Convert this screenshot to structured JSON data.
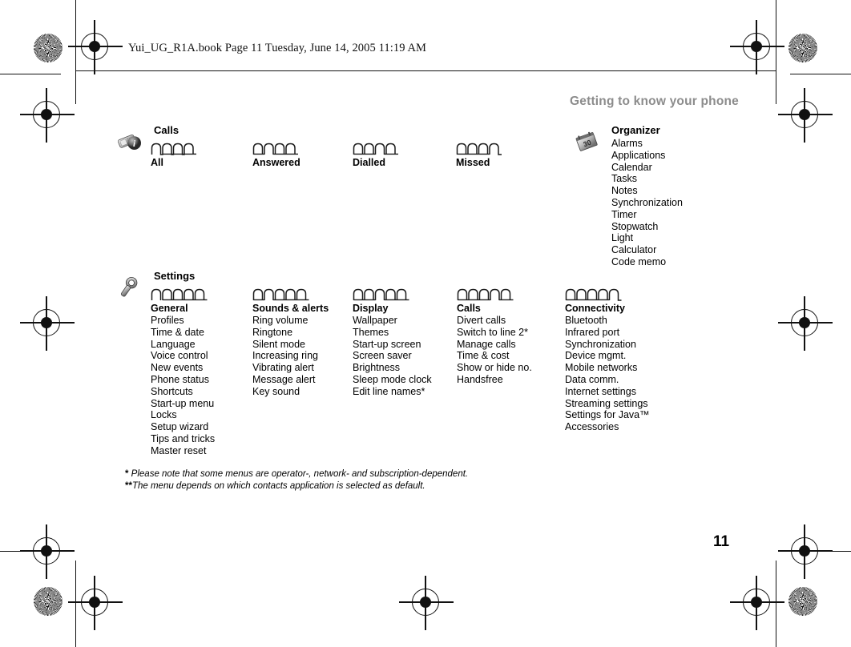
{
  "document": {
    "header_line": "Yui_UG_R1A.book  Page 11  Tuesday, June 14, 2005  11:19 AM",
    "running_head": "Getting to know your phone",
    "page_number": "11"
  },
  "calls_group": {
    "title": "Calls",
    "icon": "calls-info-icon",
    "tab_count": 4,
    "tabs": [
      {
        "label": "All",
        "selected_index": 1
      },
      {
        "label": "Answered",
        "selected_index": 2
      },
      {
        "label": "Dialled",
        "selected_index": 3
      },
      {
        "label": "Missed",
        "selected_index": 4
      }
    ]
  },
  "organizer_group": {
    "title": "Organizer",
    "icon": "organizer-calendar-icon",
    "items": [
      "Alarms",
      "Applications",
      "Calendar",
      "Tasks",
      "Notes",
      "Synchronization",
      "Timer",
      "Stopwatch",
      "Light",
      "Calculator",
      "Code memo"
    ]
  },
  "settings_group": {
    "title": "Settings",
    "icon": "settings-wrench-icon",
    "tab_count": 5,
    "columns": [
      {
        "title": "General",
        "selected_index": 1,
        "items": [
          "Profiles",
          "Time & date",
          "Language",
          "Voice control",
          "New events",
          "Phone status",
          "Shortcuts",
          "Start-up menu",
          "Locks",
          "Setup wizard",
          "Tips and tricks",
          "Master reset"
        ]
      },
      {
        "title": "Sounds & alerts",
        "selected_index": 2,
        "items": [
          "Ring volume",
          "Ringtone",
          "Silent mode",
          "Increasing ring",
          "Vibrating alert",
          "Message alert",
          "Key sound"
        ]
      },
      {
        "title": "Display",
        "selected_index": 3,
        "items": [
          "Wallpaper",
          "Themes",
          "Start-up screen",
          "Screen saver",
          "Brightness",
          "Sleep mode clock",
          "Edit line names*"
        ]
      },
      {
        "title": "Calls",
        "selected_index": 4,
        "items": [
          "Divert calls",
          "Switch to line 2*",
          "Manage calls",
          "Time & cost",
          "Show or hide no.",
          "Handsfree"
        ]
      },
      {
        "title": "Connectivity",
        "selected_index": 5,
        "items": [
          "Bluetooth",
          "Infrared port",
          "Synchronization",
          "Device mgmt.",
          "Mobile networks",
          "Data comm.",
          "Internet settings",
          "Streaming settings",
          "Settings for Java™",
          "Accessories"
        ]
      }
    ]
  },
  "footnotes": {
    "star_marker": "*",
    "line1": " Please note that some menus are operator-, network- and subscription-dependent.",
    "double_star_marker": "**",
    "line2": "The menu depends on which contacts application is selected as default."
  }
}
